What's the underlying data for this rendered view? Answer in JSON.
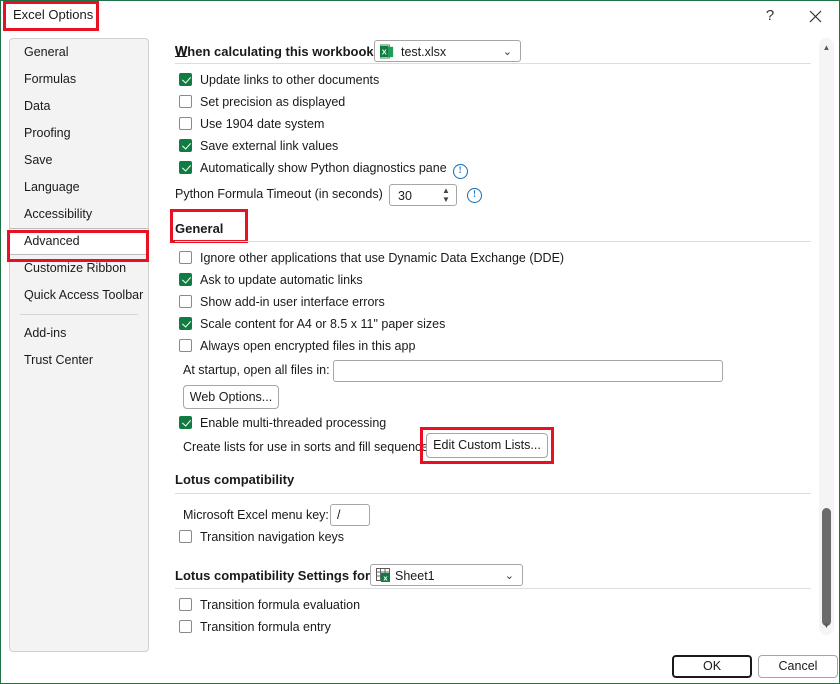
{
  "window": {
    "title": "Excel Options",
    "help_icon": "?",
    "close_icon": "close-icon"
  },
  "sidebar": {
    "items": [
      {
        "label": "General",
        "selected": false
      },
      {
        "label": "Formulas",
        "selected": false
      },
      {
        "label": "Data",
        "selected": false
      },
      {
        "label": "Proofing",
        "selected": false
      },
      {
        "label": "Save",
        "selected": false
      },
      {
        "label": "Language",
        "selected": false
      },
      {
        "label": "Accessibility",
        "selected": false
      },
      {
        "label": "Advanced",
        "selected": true
      },
      {
        "label": "Customize Ribbon",
        "selected": false
      },
      {
        "label": "Quick Access Toolbar",
        "selected": false
      },
      {
        "label": "Add-ins",
        "selected": false
      },
      {
        "label": "Trust Center",
        "selected": false
      }
    ]
  },
  "calc": {
    "label": "When calculating this workbook:",
    "workbook_value": "test.xlsx",
    "workbook_icon": "excel-file-icon",
    "caret": "⌄",
    "options": [
      {
        "label": "Update links to other documents",
        "checked": true
      },
      {
        "label": "Set precision as displayed",
        "checked": false
      },
      {
        "label": "Use 1904 date system",
        "checked": false
      },
      {
        "label": "Save external link values",
        "checked": true
      },
      {
        "label": "Automatically show Python diagnostics pane",
        "checked": true,
        "info": true
      }
    ],
    "timeout_label": "Python Formula Timeout (in seconds)",
    "timeout_value": "30",
    "timeout_info": true
  },
  "general": {
    "heading": "General",
    "options": [
      {
        "label": "Ignore other applications that use Dynamic Data Exchange (DDE)",
        "checked": false
      },
      {
        "label": "Ask to update automatic links",
        "checked": true
      },
      {
        "label": "Show add-in user interface errors",
        "checked": false
      },
      {
        "label": "Scale content for A4 or 8.5 x 11\" paper sizes",
        "checked": true
      },
      {
        "label": "Always open encrypted files in this app",
        "checked": false
      }
    ],
    "startup_label": "At startup, open all files in:",
    "startup_value": "",
    "web_options_button": "Web Options...",
    "multithread": {
      "label": "Enable multi-threaded processing",
      "checked": true
    },
    "custom_lists_label": "Create lists for use in sorts and fill sequences:",
    "custom_lists_button": "Edit Custom Lists..."
  },
  "lotus": {
    "heading": "Lotus compatibility",
    "menu_key_label": "Microsoft Excel menu key:",
    "menu_key_value": "/",
    "transition_nav": {
      "label": "Transition navigation keys",
      "checked": false
    },
    "settings_for_label": "Lotus compatibility Settings for:",
    "settings_for_value": "Sheet1",
    "settings_for_icon": "worksheet-icon",
    "caret": "⌄",
    "options": [
      {
        "label": "Transition formula evaluation",
        "checked": false
      },
      {
        "label": "Transition formula entry",
        "checked": false
      }
    ]
  },
  "footer": {
    "ok_label": "OK",
    "cancel_label": "Cancel"
  },
  "scrollbar": {
    "up_arrow": "▲",
    "down_arrow": "▼"
  },
  "colors": {
    "accent_green": "#217346",
    "checkbox_green": "#107c41",
    "highlight_red": "#e81123",
    "info_blue": "#0f6cbd"
  }
}
